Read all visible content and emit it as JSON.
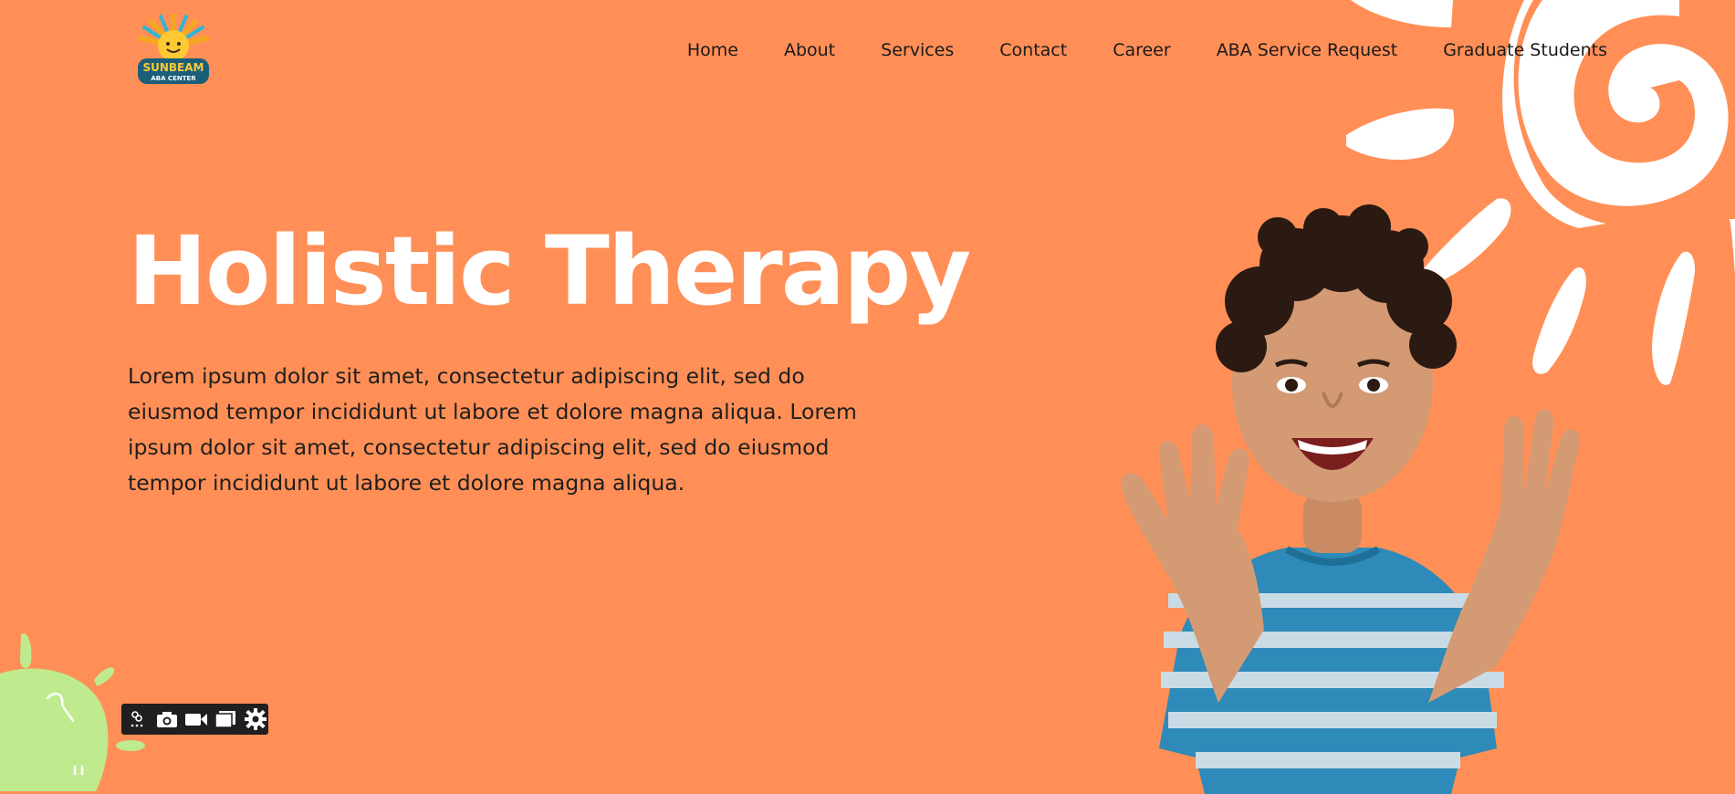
{
  "logo": {
    "brand": "SUNBEAM",
    "subtitle": "ABA CENTER"
  },
  "nav": [
    "Home",
    "About",
    "Services",
    "Contact",
    "Career",
    "ABA Service Request",
    "Graduate Students"
  ],
  "hero": {
    "title": "Holistic Therapy",
    "description": "Lorem ipsum dolor sit amet, consectetur adipiscing elit, sed do eiusmod tempor incididunt ut labore et dolore magna aliqua. Lorem ipsum dolor sit amet, consectetur adipiscing elit, sed do eiusmod tempor incididunt ut labore et dolore magna aliqua."
  },
  "toolbar": {
    "icons": [
      "link-icon",
      "camera-icon",
      "video-icon",
      "window-icon",
      "gear-icon"
    ]
  },
  "colors": {
    "background": "#FF8F56",
    "text": "#1a1a1a",
    "title": "#FFFFFF",
    "sun_white": "#FFFFFF",
    "blob_green": "#BFEA8E",
    "toolbar": "#1F1F1F"
  }
}
